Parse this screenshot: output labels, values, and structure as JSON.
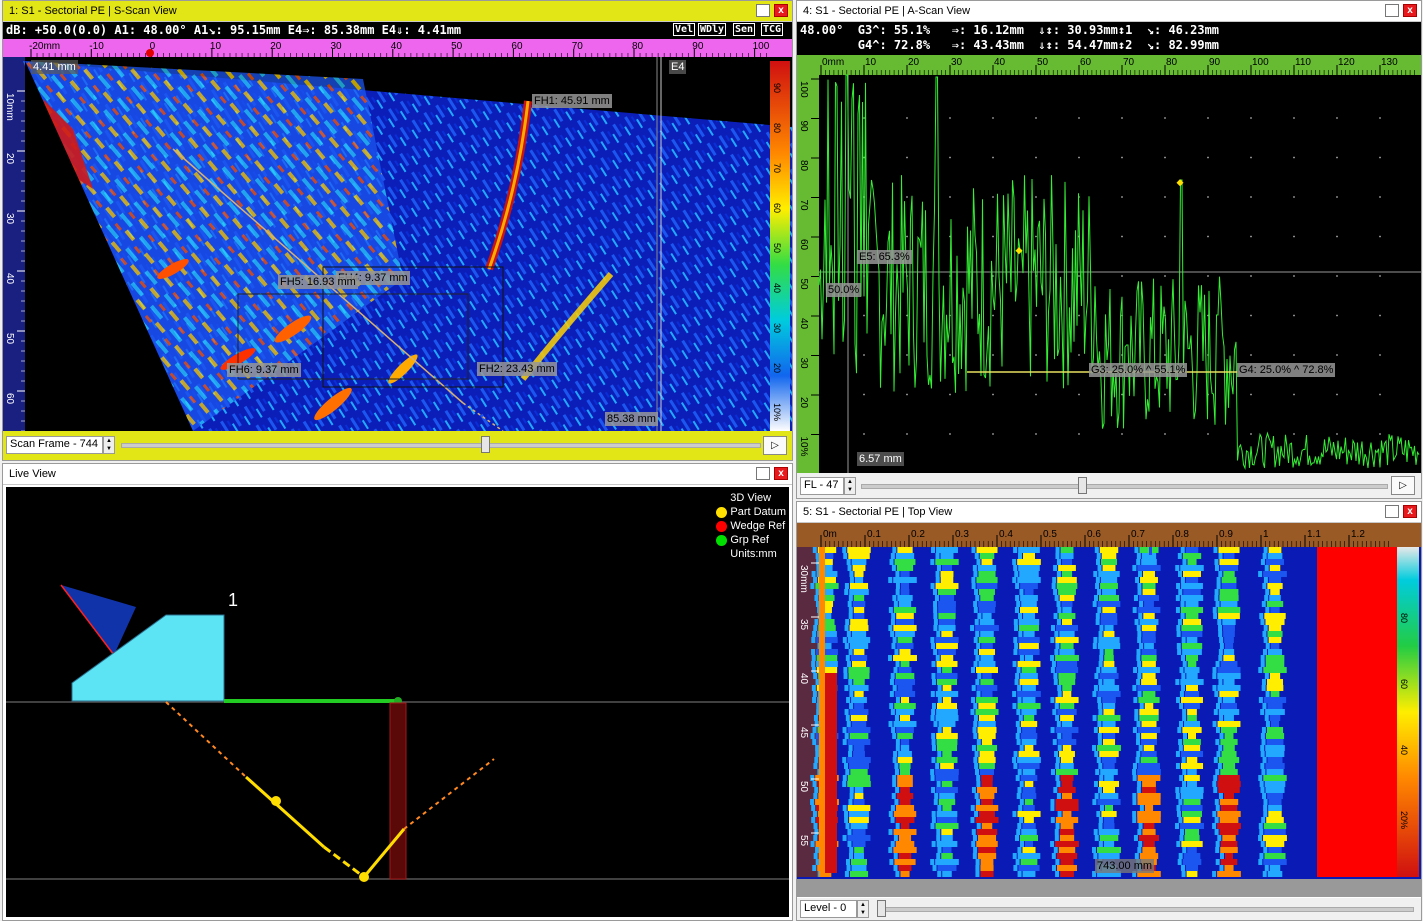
{
  "sscan": {
    "title": "1: S1 - Sectorial PE | S-Scan View",
    "info": "dB: +50.0(0.0)    A1: 48.00°  A1↘: 95.15mm   E4⇒: 85.38mm  E4⇓: 4.41mm",
    "buttons": [
      "Vel",
      "WDly",
      "Sen",
      "TCG"
    ],
    "hticks": [
      "-20mm",
      "-10",
      "0",
      "10",
      "20",
      "30",
      "40",
      "50",
      "60",
      "70",
      "80",
      "90",
      "100"
    ],
    "vticks": [
      "10mm",
      "20",
      "30",
      "40",
      "50",
      "60"
    ],
    "cticks": [
      "90",
      "80",
      "70",
      "60",
      "50",
      "40",
      "30",
      "20",
      "10%"
    ],
    "labels": {
      "top_left": "4.41 mm",
      "e4": "E4",
      "fh1": "FH1: 45.91 mm",
      "fh5": "FH5: 16.93 mm",
      "fh_overlap": "FH4: 9.37 mm",
      "fh6": "FH6: 9.37 mm",
      "fh2": "FH2: 23.43 mm",
      "bottom": "85.38 mm"
    },
    "control": {
      "label": "Scan Frame - 744",
      "slider_fraction": 0.56
    }
  },
  "ascan": {
    "title": "4: S1 - Sectorial PE | A-Scan View",
    "info_line1": "48.00°  G3^: 55.1%   ⇒: 16.12mm  ⇓↕: 30.93mm↕1  ↘: 46.23mm",
    "info_line2": "        G4^: 72.8%   ⇒: 43.43mm  ⇓↕: 54.47mm↕2  ↘: 82.99mm",
    "hticks": [
      "0mm",
      "10",
      "20",
      "30",
      "40",
      "50",
      "60",
      "70",
      "80",
      "90",
      "100",
      "110",
      "120",
      "130"
    ],
    "vticks": [
      "100",
      "90",
      "80",
      "70",
      "60",
      "50",
      "40",
      "30",
      "20",
      "10%"
    ],
    "labels": {
      "e5": "E5: 65.3%",
      "pct50": "50.0%",
      "g3": "G3: 25.0% ^ 55.1%",
      "g4": "G4: 25.0% ^ 72.8%",
      "bottom": "6.57 mm"
    },
    "control": {
      "label": "FL - 47",
      "slider_fraction": 0.41
    }
  },
  "live": {
    "title": "Live View",
    "legend_title": "3D View",
    "legend": [
      {
        "label": "Part Datum",
        "color": "#ffe000"
      },
      {
        "label": "Wedge Ref",
        "color": "#ff0000"
      },
      {
        "label": "Grp Ref",
        "color": "#00e000"
      }
    ],
    "units": "Units:mm",
    "probe_number": "1"
  },
  "topview": {
    "title": "5: S1 - Sectorial PE | Top View",
    "hticks": [
      "0m",
      "0.1",
      "0.2",
      "0.3",
      "0.4",
      "0.5",
      "0.6",
      "0.7",
      "0.8",
      "0.9",
      "1",
      "1.1",
      "1.2"
    ],
    "vticks": [
      "30mm",
      "35",
      "40",
      "45",
      "50",
      "55"
    ],
    "cticks": [
      "80",
      "60",
      "40",
      "20%"
    ],
    "labels": {
      "bottom": "743.00 mm"
    },
    "control": {
      "label": "Level - 0",
      "slider_fraction": 0.0
    }
  },
  "colors": {
    "active_titlebar": "#e3e616",
    "scale_magenta": "#ee66ee",
    "scale_green": "#66bb33",
    "scale_brown": "#9a5a26",
    "scan_bg": "#0a1ab4",
    "ascan_trace": "#33ee33",
    "wedge": "#5de4f4"
  }
}
